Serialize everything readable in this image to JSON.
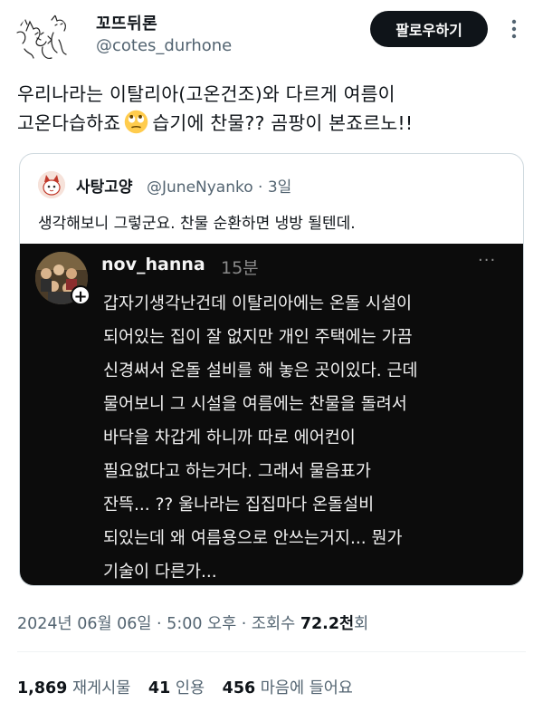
{
  "author": {
    "display_name": "꼬뜨뒤론",
    "handle": "@cotes_durhone",
    "avatar": "cat-sketch-avatar"
  },
  "header": {
    "follow_label": "팔로우하기",
    "more_icon": "more-vertical-icon"
  },
  "tweet": {
    "line1": "우리나라는 이탈리아(고온건조)와 다르게 여름이",
    "line2_before": "고온다습하죠",
    "line2_emoji": "face-with-rolling-eyes-emoji",
    "line2_after": "습기에 찬물?? 곰팡이 본죠르노!!"
  },
  "quote": {
    "name": "사탕고양",
    "handle": "@JuneNyanko",
    "separator": "·",
    "time": "3일",
    "text": "생각해보니 그렇군요. 찬물 순환하면 냉방 될텐데.",
    "screenshot": {
      "username": "nov_hanna",
      "time": "15분",
      "more": "···",
      "plus": "+",
      "lines": [
        "갑자기생각난건데 이탈리아에는 온돌 시설이",
        "되어있는 집이 잘 없지만 개인 주택에는 가끔",
        "신경써서 온돌 설비를 해 놓은 곳이있다. 근데",
        "물어보니 그 시설을 여름에는 찬물을 돌려서",
        "바닥을 차갑게 하니까 따로 에어컨이",
        "필요없다고 하는거다. 그래서 물음표가",
        "잔뜩... ?? 울나라는 집집마다 온돌설비",
        "되있는데 왜 여름용으로 안쓰는거지... 뭔가",
        "기술이 다른가..."
      ]
    }
  },
  "meta": {
    "timestamp": "2024년 06월 06일 · 5:00 오후 · 조회수",
    "views": "72.2천",
    "views_suffix": "회"
  },
  "stats": {
    "reposts_count": "1,869",
    "reposts_label": "재게시물",
    "quotes_count": "41",
    "quotes_label": "인용",
    "likes_count": "456",
    "likes_label": "마음에 들어요"
  },
  "colors": {
    "text_primary": "#0f1419",
    "text_secondary": "#536471",
    "button_bg": "#0f1419",
    "border": "#cfd9de",
    "screenshot_bg": "#0c0c0c"
  }
}
